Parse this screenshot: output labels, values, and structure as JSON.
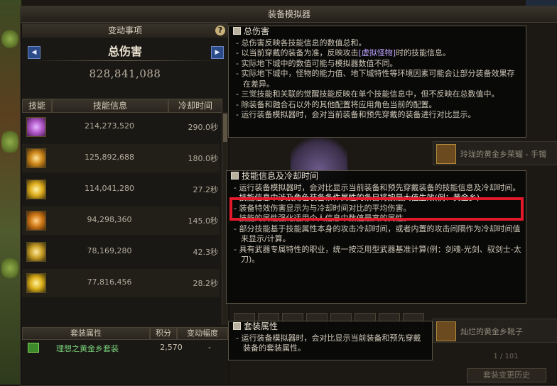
{
  "window": {
    "title": "装备模拟器"
  },
  "left_panel": {
    "header": "变动事项",
    "help_label": "?",
    "nav_prev": "◀",
    "nav_next": "▶",
    "damage_title": "总伤害",
    "damage_value": "828,841,088",
    "columns": {
      "skill": "技能",
      "info": "技能信息",
      "cooldown": "冷却时间"
    },
    "skills": [
      {
        "icon": "skill-icon-1",
        "color": "#b35acb",
        "damage": "214,273,520",
        "cooldown": "290.0秒"
      },
      {
        "icon": "skill-icon-2",
        "color": "#d08a1c",
        "damage": "125,892,688",
        "cooldown": "180.0秒"
      },
      {
        "icon": "skill-icon-3",
        "color": "#e0b020",
        "damage": "114,041,280",
        "cooldown": "27.2秒"
      },
      {
        "icon": "skill-icon-4",
        "color": "#d27a18",
        "damage": "94,298,360",
        "cooldown": "145.0秒"
      },
      {
        "icon": "skill-icon-5",
        "color": "#caa028",
        "damage": "78,169,280",
        "cooldown": "42.3秒"
      },
      {
        "icon": "skill-icon-6",
        "color": "#dcb01a",
        "damage": "77,816,456",
        "cooldown": "28.2秒"
      }
    ],
    "set_columns": {
      "attr": "套装属性",
      "score": "积分",
      "change": "变动幅度"
    },
    "set_item": {
      "name": "理想之黄金乡套装",
      "score": "2,570",
      "change": "-"
    }
  },
  "right_area": {
    "items": [
      {
        "name": "玲珑的黄金乡荣耀 - 手镯"
      },
      {
        "name": "灿烂的黄金乡靴子"
      }
    ],
    "pager": "1 / 101",
    "history_button": "套装变更历史"
  },
  "tooltips": {
    "total": {
      "title": "总伤害",
      "lines": [
        "总伤害反映各技能信息的数值总和。",
        "以当前穿戴的装备为准，反映攻击[虚拟怪物]时的技能信息。",
        "实际地下城中的数值可能与模拟器数值不同。",
        "实际地下城中，怪物的能力值、地下城特性等环境因素可能会让部分装备效果存在差异。",
        "三觉技能和关联的觉醒技能反映在单个技能信息中，但不反映在总数值中。",
        "除装备和融合石以外的其他配置将应用角色当前的配置。",
        "运行装备模拟器时，会对当前装备和预先穿戴的装备进行对比显示。"
      ]
    },
    "skill": {
      "title": "技能信息及冷却时间",
      "lines": [
        "运行装备模拟器时，会对比显示当前装备和预先穿戴装备的技能信息及冷却时间。",
        "技能信息中涉及角色装备条件属性的条目将按最大值生效(例：黄金乡)",
        "装备特效伤害显示为与冷却时间对比的平均伤害。",
        "技能的属性强化适用个人信息中数值最高的属性。",
        "部分技能基于技能属性本身的攻击冷却时间，或者内置的攻击间隔作为冷却时间值来显示/计算。",
        "具有武器专属特性的职业，统一按泛用型武器基准计算(例：剑魂-光剑、驭剑士-太刀)。"
      ]
    },
    "set": {
      "title": "套装属性",
      "lines": [
        "运行装备模拟器时，会对比显示当前装备和预先穿戴装备的套装属性。"
      ]
    }
  }
}
